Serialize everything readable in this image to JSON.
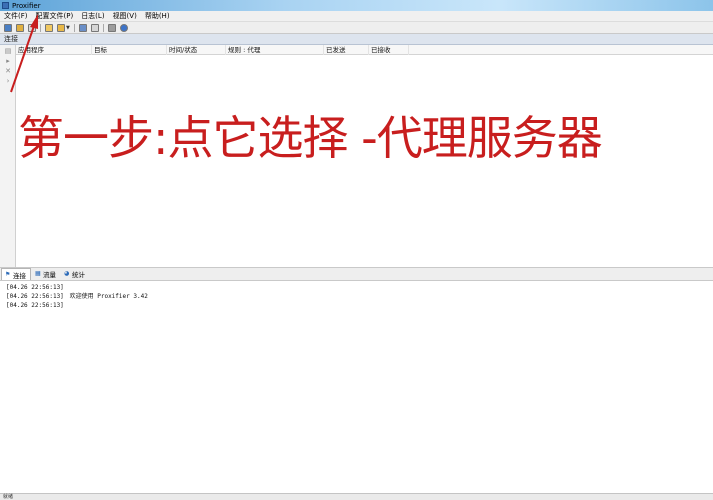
{
  "window": {
    "title": "Proxifier"
  },
  "menubar": {
    "items": [
      "文件(F)",
      "配置文件(P)",
      "日志(L)",
      "视图(V)",
      "帮助(H)"
    ]
  },
  "toolbar": {
    "icons": [
      "new-profile-icon",
      "edit-icon",
      "connect-icon",
      "open-folder-icon",
      "folder-dropdown-icon",
      "save-icon",
      "import-icon",
      "proxy-servers-icon",
      "help-icon"
    ]
  },
  "connections_panel": {
    "title": "连接",
    "columns": [
      "应用程序",
      "目标",
      "时间/状态",
      "规则 : 代理",
      "已发送",
      "已接收"
    ]
  },
  "overlay": {
    "instruction": "第一步:点它选择  -代理服务器",
    "color": "#c81e1e"
  },
  "tabs": [
    "连接",
    "流量",
    "统计"
  ],
  "log": [
    {
      "time": "[04.26 22:56:13]",
      "message": ""
    },
    {
      "time": "[04.26 22:56:13]",
      "message": "欢迎使用 Proxifier 3.42"
    },
    {
      "time": "[04.26 22:56:13]",
      "message": ""
    }
  ],
  "statusbar": {
    "text": "就绪"
  }
}
